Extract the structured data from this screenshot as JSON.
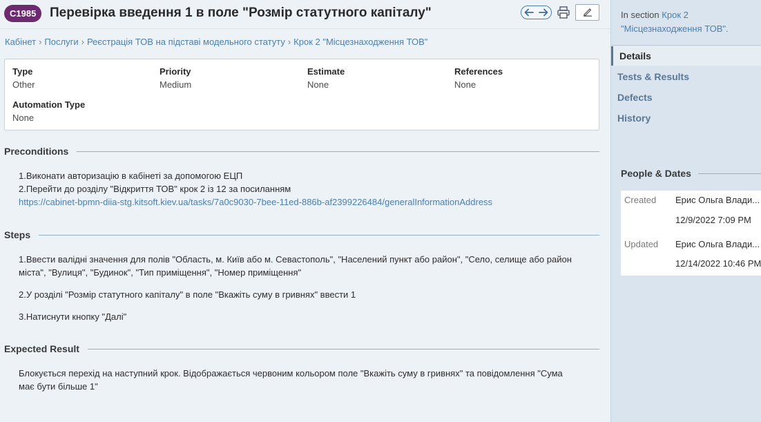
{
  "header": {
    "case_id": "C1985",
    "title": "Перевірка введення 1 в поле \"Розмір статутного капіталу\""
  },
  "breadcrumb": [
    "Кабінет",
    "Послуги",
    "Реєстрація ТОВ на підставі модельного статуту",
    "Крок 2 \"Місцезнаходження ТОВ\""
  ],
  "breadcrumb_sep": "›",
  "info": {
    "type_label": "Type",
    "type_value": "Other",
    "priority_label": "Priority",
    "priority_value": "Medium",
    "estimate_label": "Estimate",
    "estimate_value": "None",
    "references_label": "References",
    "references_value": "None",
    "automation_label": "Automation Type",
    "automation_value": "None"
  },
  "preconditions": {
    "title": "Preconditions",
    "line1": "1.Виконати авторизацію в кабінеті за допомогою ЕЦП",
    "line2": "2.Перейти до розділу \"Відкриття ТОВ\" крок 2 із 12 за посиланням",
    "link": "https://cabinet-bpmn-diia-stg.kitsoft.kiev.ua/tasks/7a0c9030-7bee-11ed-886b-af2399226484/generalInformationAddress"
  },
  "steps": {
    "title": "Steps",
    "step1_line1": "1.Ввести валідні значення для полів \"Область, м. Київ або м. Севастополь\", \"Населений пункт або район\", \"Село, селище або район",
    "step1_line2": "міста\", \"Вулиця\", \"Будинок\", \"Тип приміщення\", \"Номер приміщення\"",
    "step2": "2.У розділі \"Розмір статутного капіталу\" в поле \"Вкажіть суму в гривнях\" ввести 1",
    "step3": "3.Натиснути кнопку \"Далі\""
  },
  "expected": {
    "title": "Expected Result",
    "line1": "Блокується перехід на наступний крок. Відображається червоним кольором поле \"Вкажіть суму в гривнях\" та повідомлення \"Сума",
    "line2": "має бути більше 1\""
  },
  "sidebar": {
    "in_section_prefix": "In section",
    "section_link_line1": "Крок 2",
    "section_link_line2": "\"Місцезнаходження ТОВ\".",
    "nav": [
      "Details",
      "Tests & Results",
      "Defects",
      "History"
    ],
    "active_nav": "Details",
    "people_title": "People & Dates",
    "created_label": "Created",
    "created_by": "Ерис Ольга Влади...",
    "created_date": "12/9/2022 7:09 PM",
    "updated_label": "Updated",
    "updated_by": "Ерис Ольга Влади...",
    "updated_date": "12/14/2022 10:46 PM"
  },
  "colors": {
    "badge": "#6b2b6e",
    "link": "#4a7fb0",
    "rule": "#8fb1cc"
  },
  "icons": [
    "arrow-left-icon",
    "arrow-right-icon",
    "print-icon",
    "edit-icon"
  ]
}
